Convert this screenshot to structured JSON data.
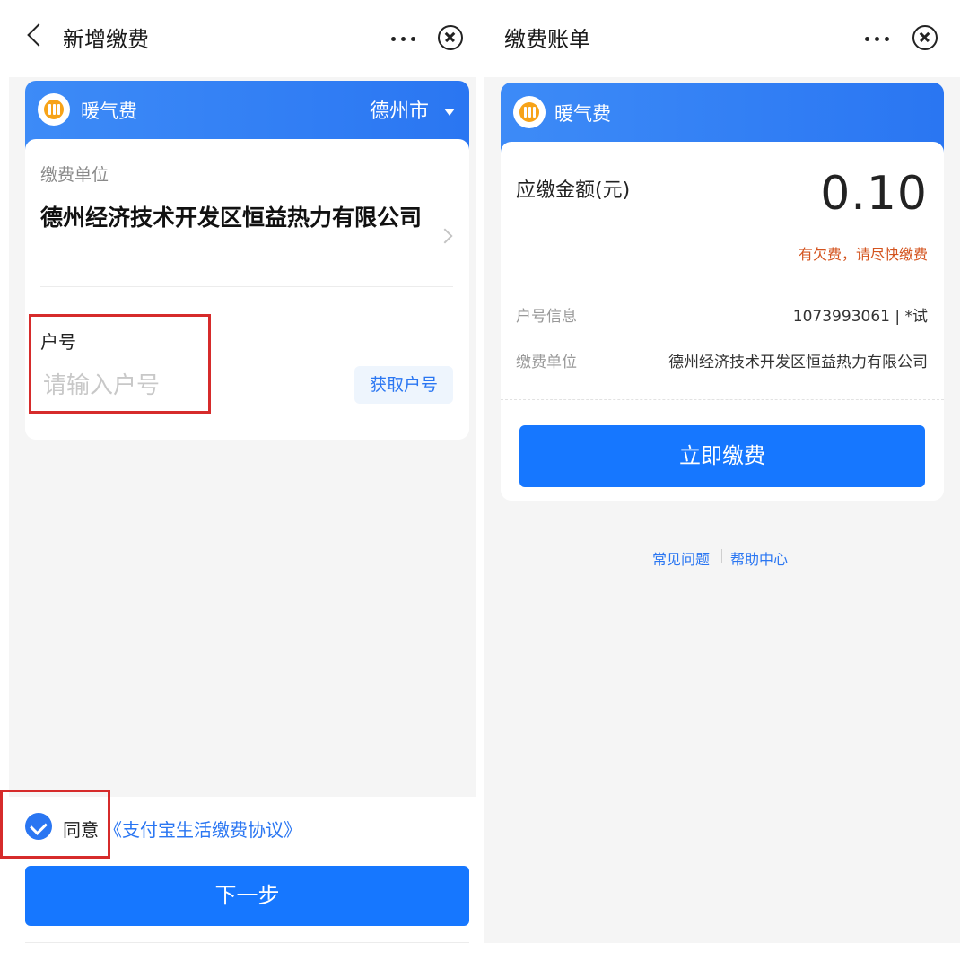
{
  "left": {
    "nav_title": "新增缴费",
    "fee_type": "暖气费",
    "city": "德州市",
    "unit_label": "缴费单位",
    "unit_name": "德州经济技术开发区恒益热力有限公司",
    "account_label": "户号",
    "account_placeholder": "请输入户号",
    "get_account_label": "获取户号",
    "agree_text": "同意",
    "agreement_link": "《支付宝生活缴费协议》",
    "next_button": "下一步"
  },
  "right": {
    "nav_title": "缴费账单",
    "fee_type": "暖气费",
    "amount_label": "应缴金额(元)",
    "amount": "0.10",
    "arrears_notice": "有欠费，请尽快缴费",
    "account_info_label": "户号信息",
    "account_info_value": "1073993061 | *试",
    "unit_label": "缴费单位",
    "unit_value": "德州经济技术开发区恒益热力有限公司",
    "pay_button": "立即缴费",
    "faq_link": "常见问题",
    "help_link": "帮助中心"
  },
  "colors": {
    "accent_blue": "#1677ff",
    "header_blue": "#2a76f2",
    "warning_orange": "#d4541f",
    "highlight_red": "#d62b2b",
    "heating_icon": "#f7a318"
  },
  "icons": [
    "back-icon",
    "more-icon",
    "close-icon",
    "heating-icon",
    "dropdown-icon",
    "chevron-right-icon",
    "checkbox-checked-icon"
  ]
}
